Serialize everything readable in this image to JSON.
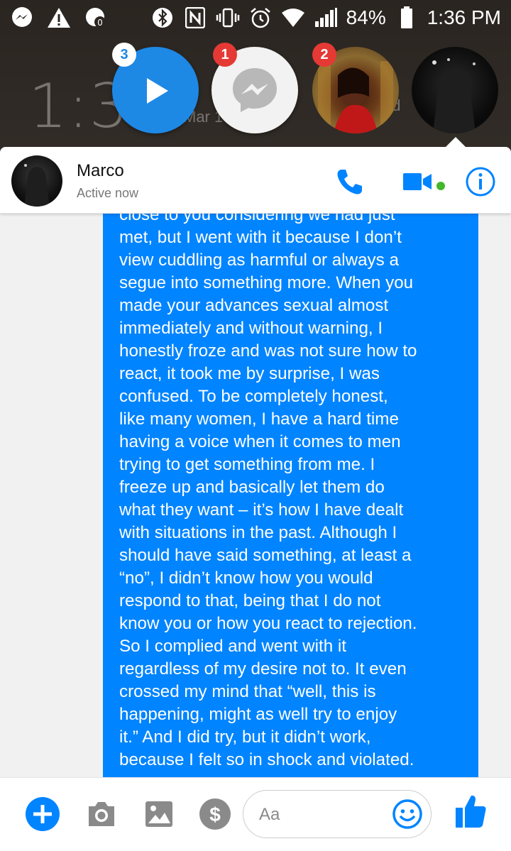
{
  "status_bar": {
    "battery": "84%",
    "time": "1:36 PM"
  },
  "lockscreen": {
    "clock": "1:36",
    "date": "Mar 1",
    "partial_text": "ad"
  },
  "chat_heads": [
    {
      "name": "video-chat-head",
      "badge": "3",
      "badge_color": "#ffffff",
      "badge_text_color": "#1e88e5"
    },
    {
      "name": "messenger-chat-head",
      "badge": "1",
      "badge_color": "#e53935",
      "badge_text_color": "#ffffff"
    },
    {
      "name": "contact-chat-head-woman",
      "badge": "2",
      "badge_color": "#e53935",
      "badge_text_color": "#ffffff"
    },
    {
      "name": "contact-chat-head-marco",
      "badge": ""
    }
  ],
  "header": {
    "contact_name": "Marco",
    "contact_status": "Active now",
    "icons": [
      "phone-icon",
      "video-camera-icon",
      "info-icon"
    ],
    "accent_color": "#0084ff",
    "active_dot_color": "#42b72a"
  },
  "message": {
    "text": "close to you considering we had just\nmet, but I went with it because I don’t\nview cuddling as harmful or always a\nsegue into something more. When you\nmade your advances sexual almost\nimmediately and without warning, I\nhonestly froze and was not sure how to\nreact, it took me by surprise, I was\nconfused. To be completely honest,\nlike many women, I have a hard time\nhaving a voice when it comes to men\ntrying to get something from me. I\nfreeze up and basically let them do\nwhat they want – it’s how I have dealt\nwith situations in the past. Although I\nshould have said something, at least a\n“no”, I didn’t know how you would\nrespond to that, being that I do not\nknow you or how you react to rejection.\nSo I complied and went with it\nregardless of my desire not to. It even\ncrossed my mind that “well, this is\nhappening, might as well try to enjoy\nit.” And I did try, but it didn’t work,\nbecause I felt so in shock and violated.",
    "bubble_color": "#0084ff"
  },
  "composer": {
    "placeholder": "Aa",
    "buttons": [
      "plus-icon",
      "camera-icon",
      "image-icon",
      "dollar-icon",
      "emoji-icon",
      "thumbs-up-icon"
    ]
  }
}
